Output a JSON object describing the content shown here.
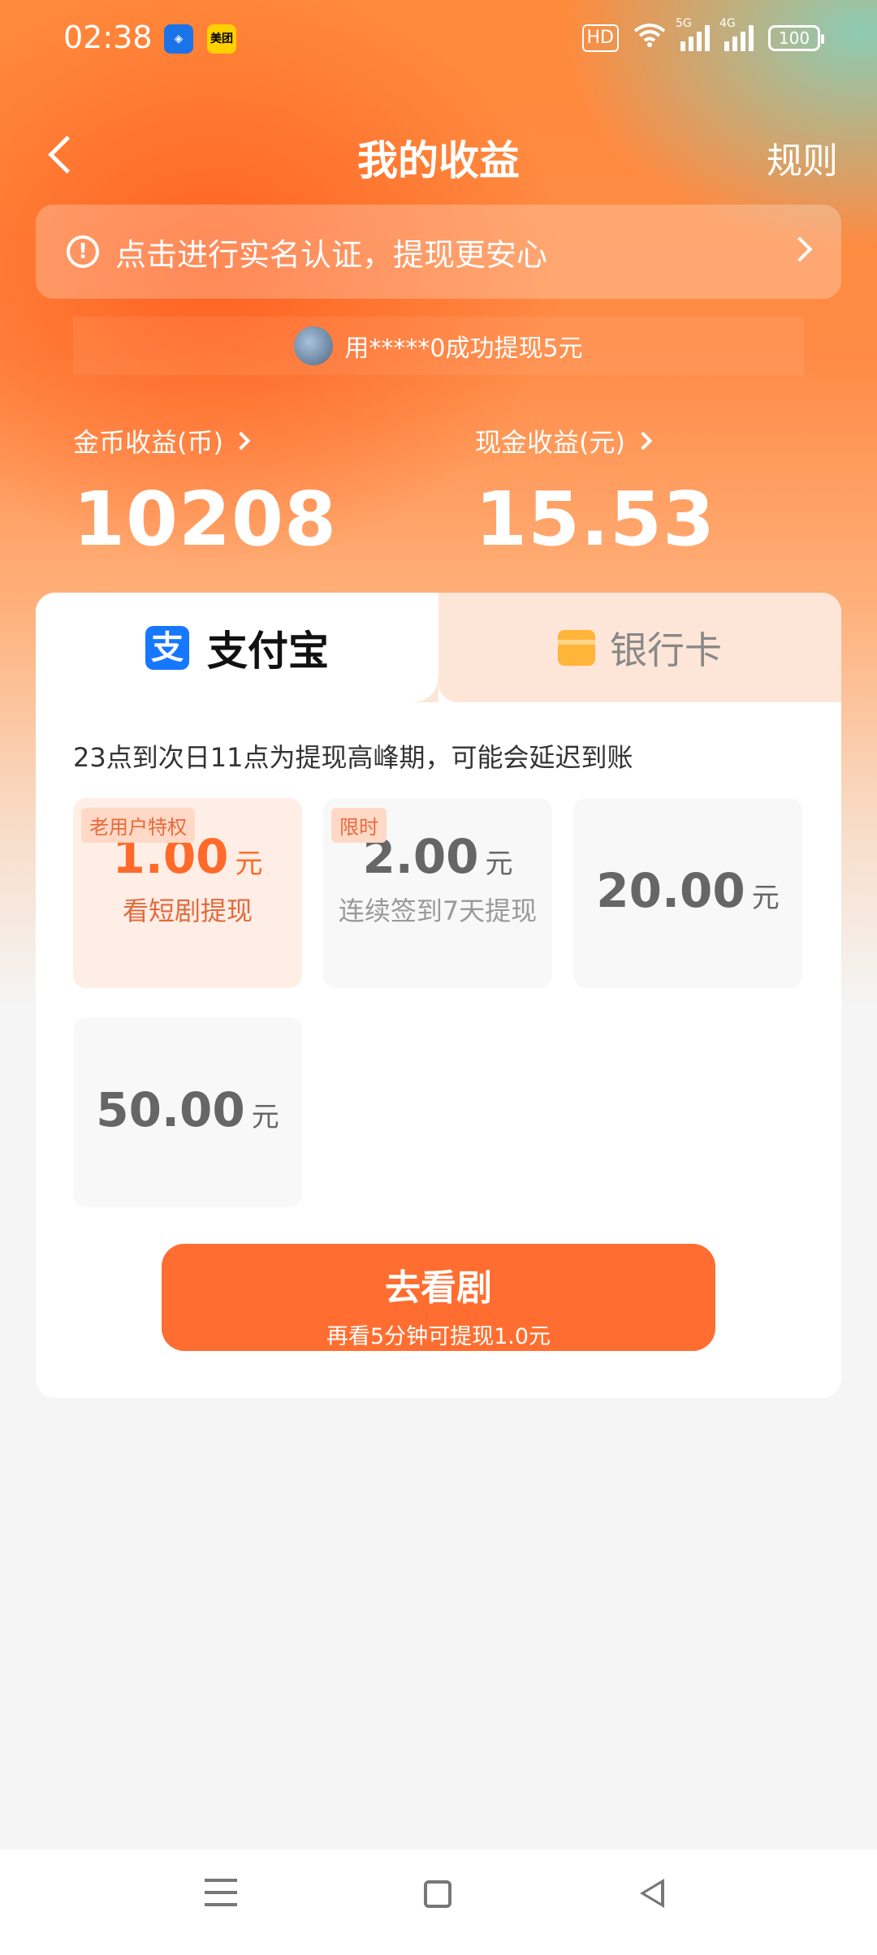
{
  "status_bar": {
    "time": "02:38",
    "app_icons": [
      "shield-icon",
      "meituan-icon"
    ],
    "meituan_label": "美团",
    "hd_label": "HD",
    "net1": "5G",
    "net2": "4G",
    "battery": "100"
  },
  "nav": {
    "title": "我的收益",
    "rules_label": "规则"
  },
  "auth_banner": {
    "text": "点击进行实名认证，提现更安心"
  },
  "ticker": {
    "text": "用*****0成功提现5元"
  },
  "earnings": {
    "coins_label": "金币收益(币)",
    "coins_value": "10208",
    "cash_label": "现金收益(元)",
    "cash_value": "15.53"
  },
  "tabs": {
    "alipay_label": "支付宝",
    "bank_label": "银行卡"
  },
  "notice": "23点到次日11点为提现高峰期，可能会延迟到账",
  "options": [
    {
      "badge": "老用户特权",
      "amount": "1.00",
      "unit": "元",
      "sub": "看短剧提现"
    },
    {
      "badge": "限时",
      "amount": "2.00",
      "unit": "元",
      "sub": "连续签到7天提现"
    },
    {
      "amount": "20.00",
      "unit": "元"
    },
    {
      "amount": "50.00",
      "unit": "元"
    }
  ],
  "cta": {
    "title": "去看剧",
    "sub": "再看5分钟可提现1.0元"
  },
  "colors": {
    "accent": "#ff6e30",
    "alipay_blue": "#1677ff",
    "bank_orange": "#ffb43a"
  }
}
